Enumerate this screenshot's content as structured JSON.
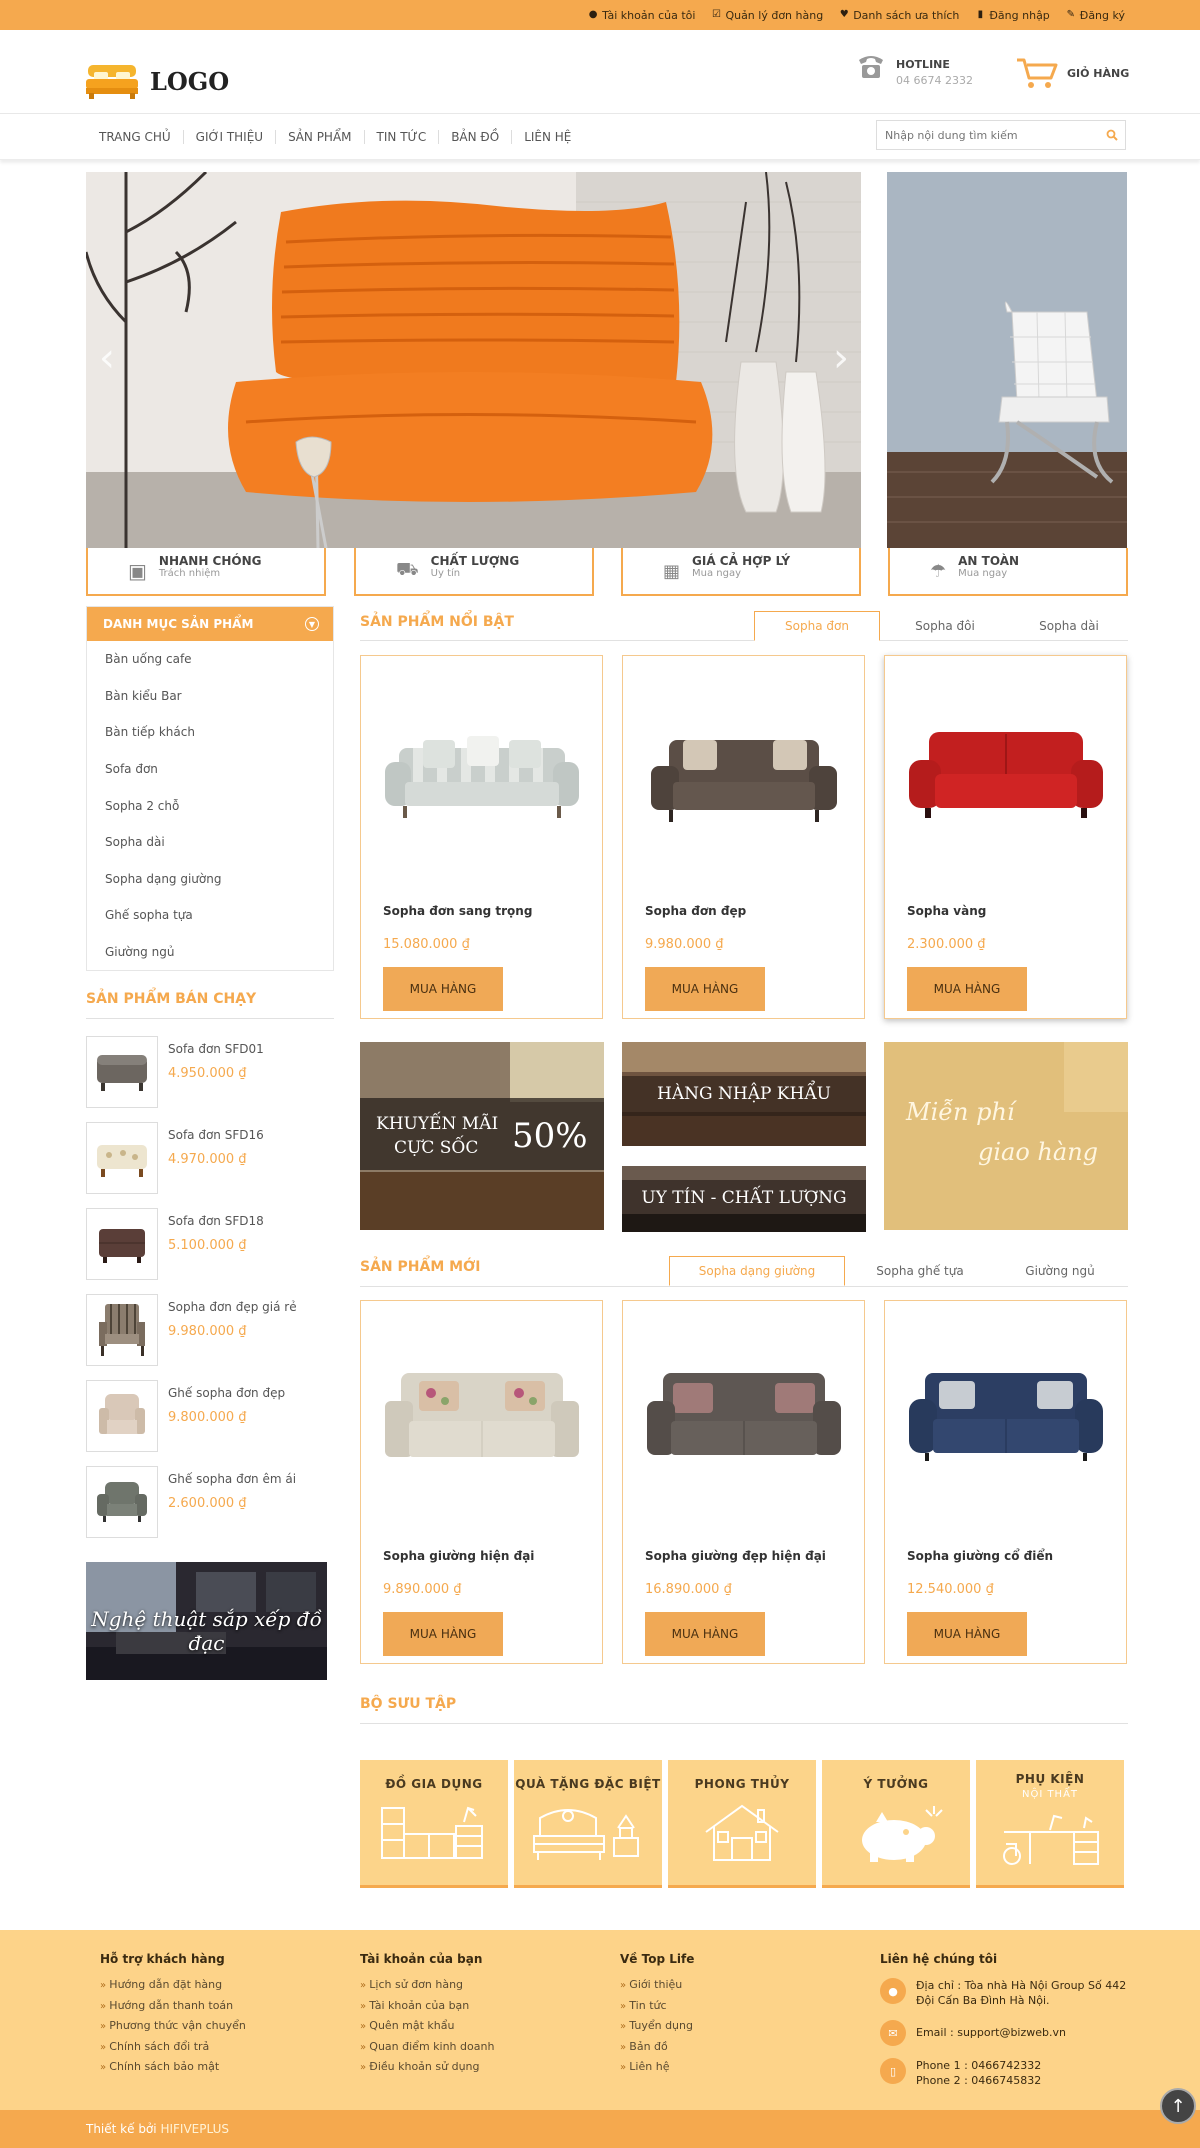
{
  "topbar": {
    "links": [
      {
        "label": "Tài khoản của tôi",
        "icon": "user-icon"
      },
      {
        "label": "Quản lý đơn hàng",
        "icon": "checkbox-icon"
      },
      {
        "label": "Danh sách ưa thích",
        "icon": "heart-icon"
      },
      {
        "label": "Đăng nhập",
        "icon": "login-icon"
      },
      {
        "label": "Đăng ký",
        "icon": "pencil-icon"
      }
    ]
  },
  "header": {
    "logo": "LOGO",
    "hotline_label": "HOTLINE",
    "hotline_number": "04 6674 2332",
    "cart_label": "GIỎ HÀNG"
  },
  "nav": {
    "items": [
      "TRANG CHỦ",
      "GIỚI THIỆU",
      "SẢN PHẨM",
      "TIN TỨC",
      "BẢN ĐỒ",
      "LIÊN HỆ"
    ],
    "search_placeholder": "Nhập nội dung tìm kiếm"
  },
  "features": [
    {
      "title": "NHANH CHÓNG",
      "sub": "Trách nhiệm",
      "icon": "money-icon"
    },
    {
      "title": "CHẤT LƯỢNG",
      "sub": "Uy tín",
      "icon": "truck-icon"
    },
    {
      "title": "GIÁ CẢ HỢP LÝ",
      "sub": "Mua ngay",
      "icon": "calculator-icon"
    },
    {
      "title": "AN TOÀN",
      "sub": "Mua ngay",
      "icon": "umbrella-icon"
    }
  ],
  "categories": {
    "title": "DANH MỤC SẢN PHẨM",
    "items": [
      "Bàn uống cafe",
      "Bàn kiểu Bar",
      "Bàn tiếp khách",
      "Sofa đơn",
      "Sopha 2 chỗ",
      "Sopha dài",
      "Sopha dạng giường",
      "Ghế sopha tựa",
      "Giường ngủ"
    ]
  },
  "bestsellers": {
    "title": "SẢN PHẨM BÁN CHẠY",
    "items": [
      {
        "name": "Sofa đơn SFD01",
        "price": "4.950.000 ₫"
      },
      {
        "name": "Sofa đơn SFD16",
        "price": "4.970.000 ₫"
      },
      {
        "name": "Sofa đơn SFD18",
        "price": "5.100.000 ₫"
      },
      {
        "name": "Sopha đơn đẹp giá rẻ",
        "price": "9.980.000 ₫"
      },
      {
        "name": "Ghế sopha đơn đẹp",
        "price": "9.800.000 ₫"
      },
      {
        "name": "Ghế sopha đơn êm ái",
        "price": "2.600.000 ₫"
      }
    ],
    "banner_text": "Nghệ thuật sắp xếp đồ đạc"
  },
  "featured": {
    "title": "SẢN PHẨM NỔI BẬT",
    "tabs": [
      "Sopha đơn",
      "Sopha đôi",
      "Sopha dài"
    ],
    "products": [
      {
        "name": "Sopha đơn sang trọng",
        "price": "15.080.000 ₫",
        "buy": "MUA HÀNG"
      },
      {
        "name": "Sopha đơn đẹp",
        "price": "9.980.000 ₫",
        "buy": "MUA HÀNG"
      },
      {
        "name": "Sopha vàng",
        "price": "2.300.000 ₫",
        "buy": "MUA HÀNG"
      }
    ]
  },
  "promos": {
    "sale_line1": "KHUYẾN MÃI",
    "sale_line2": "CỰC SỐC",
    "sale_percent": "50%",
    "import": "HÀNG NHẬP KHẨU",
    "trust": "UY TÍN - CHẤT LƯỢNG",
    "ship_line1": "Miễn phí",
    "ship_line2": "giao hàng"
  },
  "new_products": {
    "title": "SẢN PHẨM MỚI",
    "tabs": [
      "Sopha dạng giường",
      "Sopha ghế tựa",
      "Giường ngủ"
    ],
    "products": [
      {
        "name": "Sopha giường hiện đại",
        "price": "9.890.000 ₫",
        "buy": "MUA HÀNG"
      },
      {
        "name": "Sopha giường đẹp hiện đại",
        "price": "16.890.000 ₫",
        "buy": "MUA HÀNG"
      },
      {
        "name": "Sopha giường cổ điển",
        "price": "12.540.000 ₫",
        "buy": "MUA HÀNG"
      }
    ]
  },
  "collection": {
    "title": "BỘ SƯU TẬP",
    "items": [
      {
        "label": "ĐỒ GIA DỤNG"
      },
      {
        "label": "QUÀ TẶNG ĐẶC BIỆT"
      },
      {
        "label": "PHONG THỦY"
      },
      {
        "label": "Ý TƯỞNG"
      },
      {
        "label": "PHỤ KIỆN",
        "sub": "NỘI THẤT"
      }
    ]
  },
  "footer": {
    "cols": [
      {
        "title": "Hỗ trợ khách hàng",
        "links": [
          "Hướng dẫn đặt hàng",
          "Hướng dẫn thanh toán",
          "Phương thức vận chuyển",
          "Chính sách đổi trả",
          "Chính sách bảo mật"
        ]
      },
      {
        "title": "Tài khoản của bạn",
        "links": [
          "Lịch sử đơn hàng",
          "Tài khoản của bạn",
          "Quên mật khẩu",
          "Quan điểm kinh doanh",
          "Điều khoản sử dụng"
        ]
      },
      {
        "title": "Về Top Life",
        "links": [
          "Giới thiệu",
          "Tin tức",
          "Tuyển dụng",
          "Bản đồ",
          "Liên hệ"
        ]
      }
    ],
    "contact": {
      "title": "Liên hệ chúng tôi",
      "address1": "Địa chỉ : Tòa nhà Hà Nội Group Số 442",
      "address2": "Đội Cấn Ba Đình Hà Nội.",
      "email": "Email : support@bizweb.vn",
      "phone1": "Phone 1 : 0466742332",
      "phone2": "Phone 2 : 0466745832"
    },
    "credit_prefix": "Thiết kế bởi",
    "credit_name": "HIFIVEPLUS"
  },
  "colors": {
    "accent": "#f5a94e",
    "footer_bg": "#fdd389"
  }
}
